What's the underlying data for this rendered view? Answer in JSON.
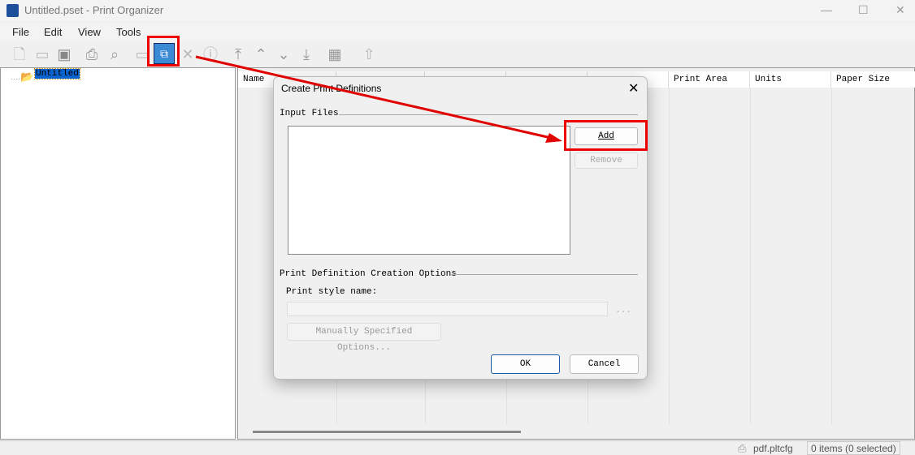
{
  "window": {
    "title": "Untitled.pset - Print Organizer"
  },
  "menu": [
    "File",
    "Edit",
    "View",
    "Tools"
  ],
  "toolbar": {
    "icons": [
      "new-icon",
      "open-icon",
      "save-icon",
      "print-icon",
      "preview-icon",
      "folder-add-icon",
      "create-print-definitions-icon",
      "delete-icon",
      "properties-icon",
      "move-top-icon",
      "move-up-icon",
      "move-down-icon",
      "move-bottom-icon",
      "view-options-icon",
      "export-icon"
    ]
  },
  "tree": {
    "root": "Untitled"
  },
  "list": {
    "columns": [
      "Name",
      "",
      "",
      "",
      "",
      "Print Area",
      "Units",
      "Paper Size"
    ]
  },
  "dialog": {
    "title": "Create Print Definitions",
    "input_files_label": "Input Files",
    "add": "Add",
    "remove": "Remove",
    "options_label": "Print Definition Creation Options",
    "style_name_label": "Print style name:",
    "style_name_value": "",
    "browse": "...",
    "manual_options": "Manually Specified Options...",
    "ok": "OK",
    "cancel": "Cancel"
  },
  "status": {
    "config": "pdf.pltcfg",
    "items": "0 items (0 selected)"
  },
  "annotation_color": "#e00000"
}
